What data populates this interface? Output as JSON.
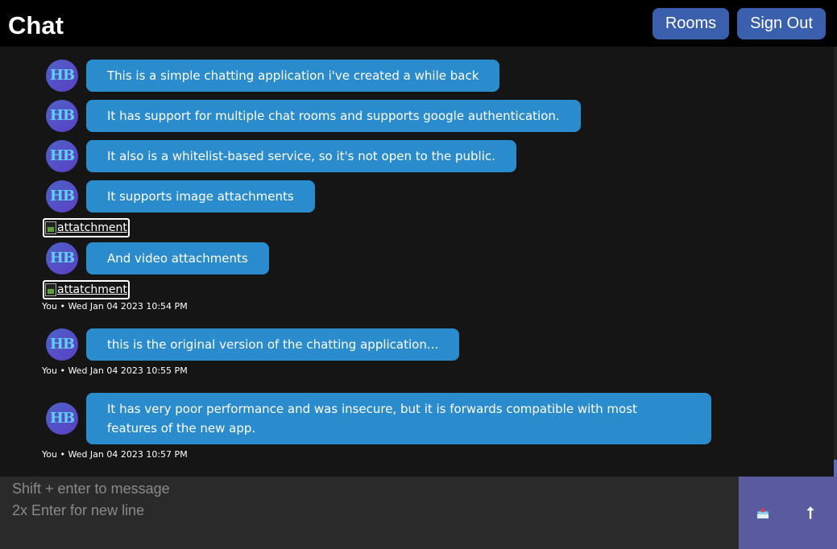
{
  "header": {
    "title": "Chat",
    "rooms_label": "Rooms",
    "signout_label": "Sign Out"
  },
  "avatar_initials": "HB",
  "messages": [
    {
      "text": "This is a simple chatting application i've created a while back"
    },
    {
      "text": "It has support for multiple chat rooms and supports google authentication."
    },
    {
      "text": "It also is a whitelist-based service, so it's not open to the public."
    },
    {
      "text": "It supports image attachments"
    },
    {
      "attachment": "attatchment"
    },
    {
      "text": "And video attachments"
    },
    {
      "attachment": "attatchment"
    },
    {
      "meta": "You • Wed Jan 04 2023 10:54 PM"
    },
    {
      "text": "this is the original version of the chatting application..."
    },
    {
      "meta": "You • Wed Jan 04 2023 10:55 PM"
    },
    {
      "text": "It has very poor performance and was insecure, but it is forwards compatible with most features of the new app."
    },
    {
      "meta": "You • Wed Jan 04 2023 10:57 PM"
    }
  ],
  "composer": {
    "placeholder": "Shift + enter to message\n2x Enter for new line"
  },
  "actions": {
    "attach_icon": "attachment-box-icon",
    "send_icon": "arrow-up-icon",
    "send_glyph": "⭡"
  },
  "colors": {
    "bubble": "#2a8bcd",
    "header_button": "#3a60ad",
    "action_panel": "#5a5a9e",
    "background": "#151515"
  }
}
